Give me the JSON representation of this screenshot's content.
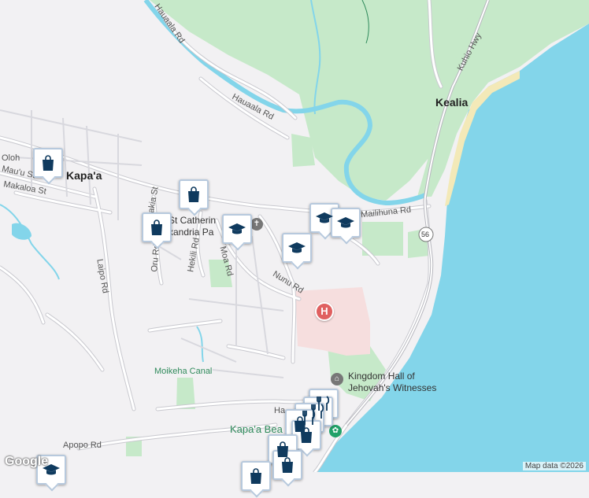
{
  "map": {
    "labels": {
      "kealia": "Kealia",
      "kapaa": "Kapa'a",
      "kuhio_hwy": "Kuhio Hwy",
      "hauaala_rd_top": "Hauaala Rd",
      "hauaala_rd": "Hauaala Rd",
      "olohena": "Oloh",
      "mauu_st": "Mau'u St",
      "makaloa_st": "Makaloa St",
      "akia_st": "akia St",
      "laipo_rd": "Laipo Rd",
      "oru_rd": "Oru Rd",
      "hekili_rd": "Hekili Rd",
      "moa_rd": "Moa Rd",
      "nunu_rd": "Nunu Rd",
      "mailihuna_rd": "Mailihuna Rd",
      "hwy_56": "56",
      "church_line1": "St Catherin",
      "church_line2": "xandria Pa",
      "kingdom_hall_1": "Kingdom Hall of",
      "kingdom_hall_2": "Jehovah's Witnesses",
      "moikeha_canal": "Moikeha Canal",
      "kapaa_beach": "Kapa'a Bea",
      "apopo_rd": "Apopo Rd",
      "ha": "Ha"
    },
    "pins": [
      {
        "id": "shopping-1",
        "icon": "shopping-bag-icon"
      },
      {
        "id": "shopping-2",
        "icon": "shopping-bag-icon"
      },
      {
        "id": "shopping-3",
        "icon": "shopping-bag-icon"
      },
      {
        "id": "school-1",
        "icon": "graduation-cap-icon"
      },
      {
        "id": "school-2",
        "icon": "graduation-cap-icon"
      },
      {
        "id": "school-3",
        "icon": "graduation-cap-icon"
      },
      {
        "id": "school-4",
        "icon": "graduation-cap-icon"
      }
    ],
    "hospital_symbol": "H",
    "google": "Google",
    "attribution": "Map data ©2026",
    "colors": {
      "land": "#f2f1f3",
      "water": "#83d5ea",
      "park": "#c6e9c9",
      "hospital": "#f6dede",
      "road": "#ffffff",
      "road_outline": "#c9c9cf",
      "pin_icon": "#0f3a5e"
    }
  }
}
